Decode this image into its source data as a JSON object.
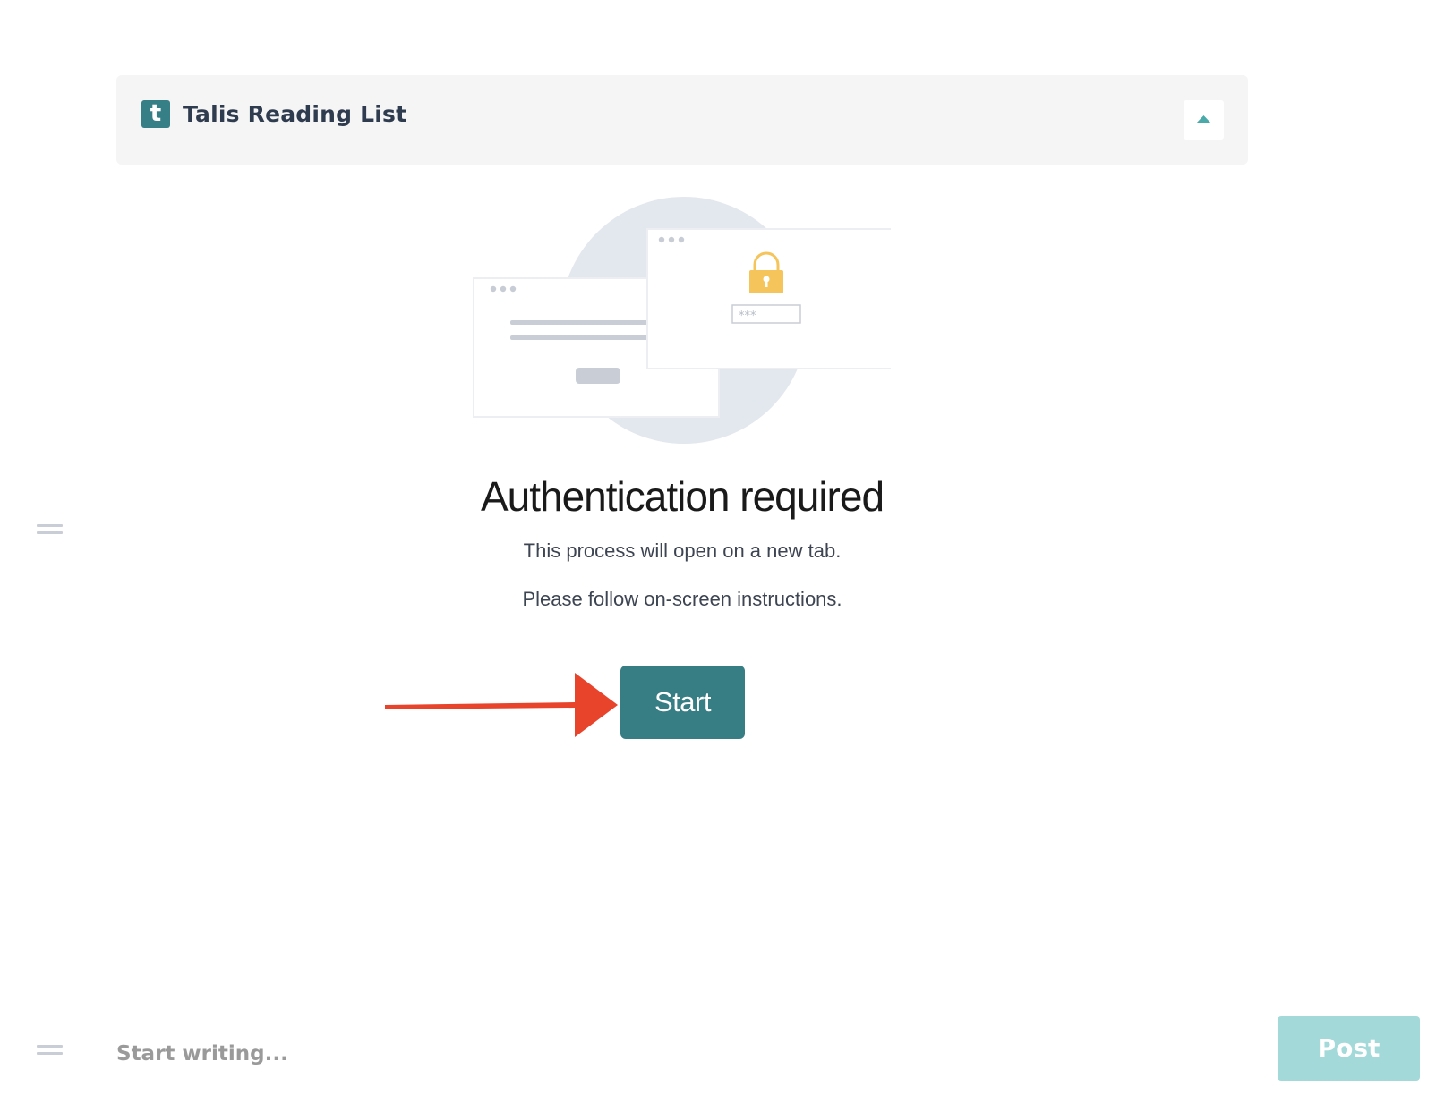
{
  "header": {
    "logo_letter": "t",
    "title": "Talis Reading List",
    "collapse_icon": "chevron-up-icon"
  },
  "illustration": {
    "icon": "browser-windows-lock-illustration",
    "password_mask": "***",
    "window_dots": "• • •"
  },
  "auth": {
    "title": "Authentication required",
    "line1": "This process will open on a new tab.",
    "line2": "Please follow on-screen instructions.",
    "start_label": "Start"
  },
  "composer": {
    "placeholder": "Start writing...",
    "post_label": "Post"
  },
  "colors": {
    "accent": "#367d84",
    "post_disabled": "#a3d9d9",
    "lock": "#f5c45a",
    "annotation": "#e8432b"
  }
}
